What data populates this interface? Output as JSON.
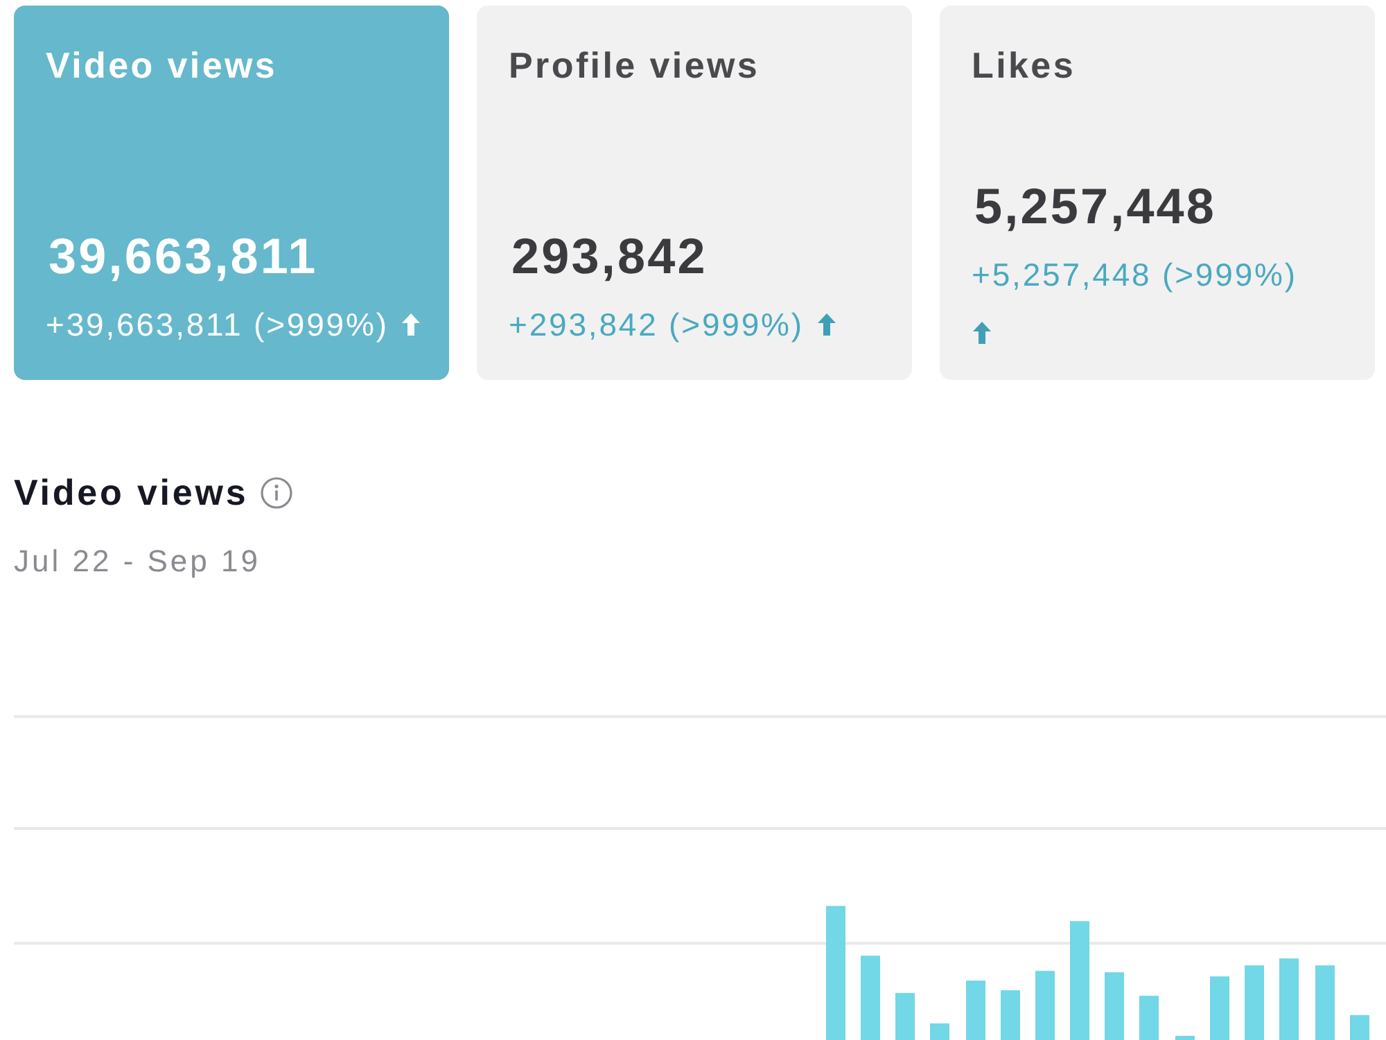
{
  "metric_cards": [
    {
      "title": "Video views",
      "value": "39,663,811",
      "change": "+39,663,811 (>999%)",
      "trend_up": true,
      "selected": true
    },
    {
      "title": "Profile views",
      "value": "293,842",
      "change": "+293,842 (>999%)",
      "trend_up": true,
      "selected": false
    },
    {
      "title": "Likes",
      "value": "5,257,448",
      "change": "+5,257,448 (>999%)",
      "trend_up": true,
      "selected": false
    }
  ],
  "chart_section": {
    "title": "Video views",
    "date_range": "Jul 22 - Sep 19"
  }
}
